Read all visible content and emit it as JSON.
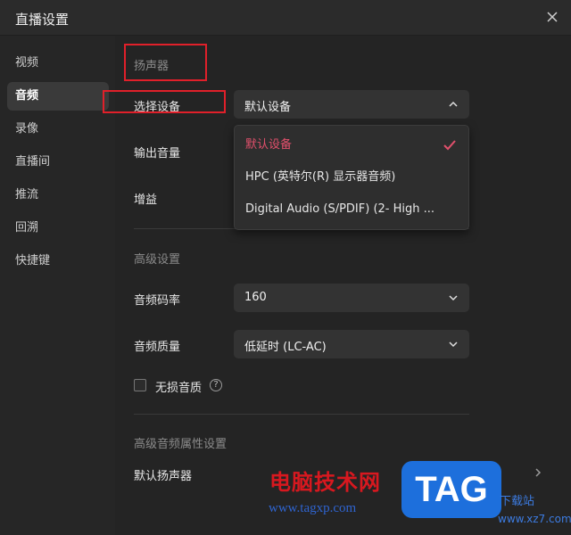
{
  "window": {
    "title": "直播设置"
  },
  "sidebar": {
    "items": [
      {
        "label": "视频"
      },
      {
        "label": "音频"
      },
      {
        "label": "录像"
      },
      {
        "label": "直播间"
      },
      {
        "label": "推流"
      },
      {
        "label": "回溯"
      },
      {
        "label": "快捷键"
      }
    ]
  },
  "speaker": {
    "section_title": "扬声器",
    "device_label": "选择设备",
    "device_value": "默认设备",
    "volume_label": "输出音量",
    "gain_label": "增益",
    "options": [
      {
        "label": "默认设备"
      },
      {
        "label": "HPC (英特尔(R) 显示器音频)"
      },
      {
        "label": "Digital Audio (S/PDIF) (2- High ..."
      }
    ]
  },
  "advanced": {
    "section_title": "高级设置",
    "bitrate_label": "音频码率",
    "bitrate_value": "160",
    "quality_label": "音频质量",
    "quality_value": "低延时 (LC-AC)",
    "lossless_label": "无损音质"
  },
  "advanced_audio": {
    "section_title": "高级音频属性设置",
    "default_speaker_label": "默认扬声器"
  },
  "watermark": {
    "cn_text": "电脑技术网",
    "url_text": "www.tagxp.com",
    "tag_text": "TAG",
    "dl_text": "下载站",
    "dl_url": "www.xz7.com"
  },
  "colors": {
    "accent": "#e2506c",
    "highlight_box": "#e0202a",
    "background": "#242424"
  }
}
